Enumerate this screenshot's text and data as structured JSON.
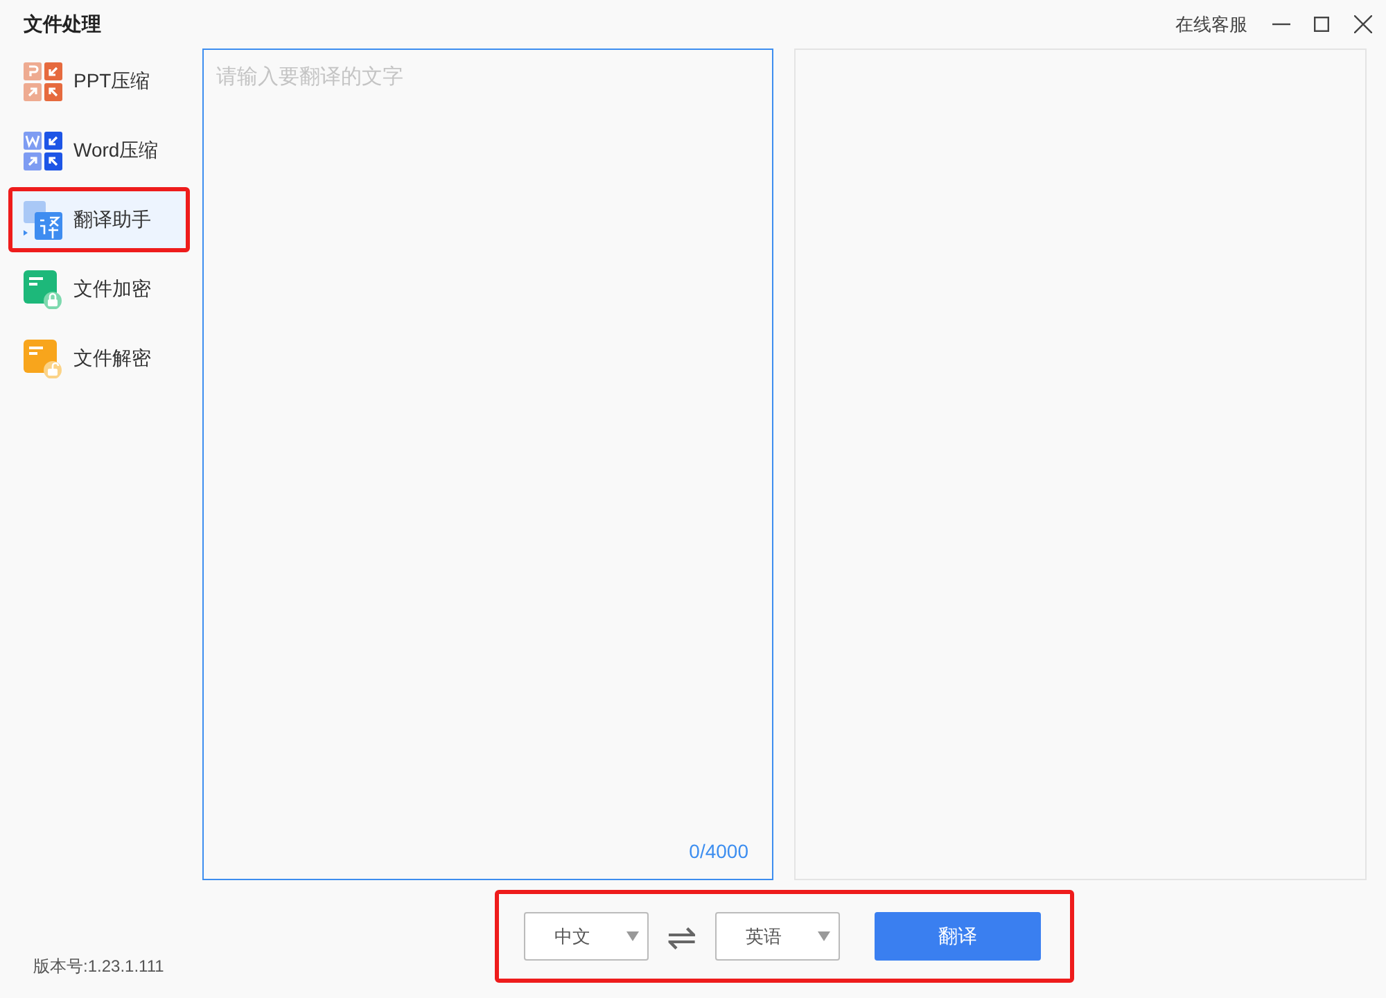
{
  "window": {
    "title": "文件处理",
    "support_link": "在线客服"
  },
  "sidebar": {
    "items": [
      {
        "kind": "ppt",
        "label": "PPT压缩",
        "selected": false
      },
      {
        "kind": "word",
        "label": "Word压缩",
        "selected": false
      },
      {
        "kind": "translate",
        "label": "翻译助手",
        "selected": true
      },
      {
        "kind": "encrypt",
        "label": "文件加密",
        "selected": false
      },
      {
        "kind": "decrypt",
        "label": "文件解密",
        "selected": false
      }
    ]
  },
  "source": {
    "placeholder": "请输入要翻译的文字",
    "count": "0/4000"
  },
  "controls": {
    "source_language": "中文",
    "swap": "⇌",
    "target_language": "英语",
    "translate_button": "翻译"
  },
  "version": "版本号:1.23.1.111"
}
